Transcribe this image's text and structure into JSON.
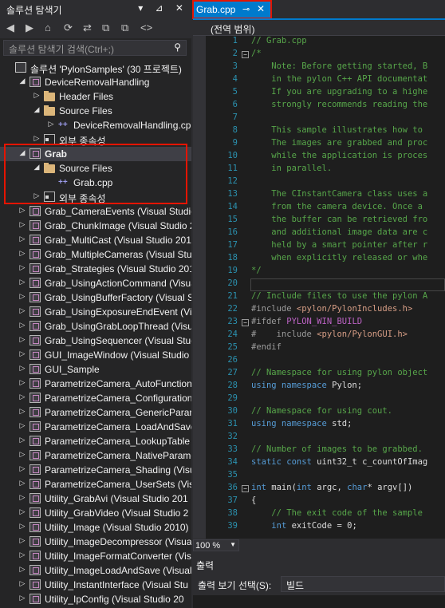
{
  "solution_explorer": {
    "title": "솔루션 탐색기",
    "title_buttons": "▾ ⊿ ✕",
    "toolbar": [
      "◀",
      "▶",
      "⌂",
      "⟳",
      "⇄",
      "⧉",
      "⧉",
      "<>"
    ],
    "search_placeholder": "솔루션 탐색기 검색(Ctrl+;)",
    "search_icon": "search-icon",
    "items": [
      {
        "label": "솔루션 'PylonSamples' (30 프로젝트)",
        "indent": 0,
        "arrow": "",
        "icon": "sln"
      },
      {
        "label": "DeviceRemovalHandling",
        "indent": 1,
        "arrow": "◢",
        "icon": "proj"
      },
      {
        "label": "Header Files",
        "indent": 2,
        "arrow": "▷",
        "icon": "folder"
      },
      {
        "label": "Source Files",
        "indent": 2,
        "arrow": "◢",
        "icon": "folder"
      },
      {
        "label": "DeviceRemovalHandling.cpp",
        "indent": 3,
        "arrow": "▷",
        "icon": "cpp"
      },
      {
        "label": "외부 종속성",
        "indent": 2,
        "arrow": "▷",
        "icon": "ref"
      },
      {
        "label": "Grab",
        "indent": 1,
        "arrow": "◢",
        "icon": "proj",
        "bold": true
      },
      {
        "label": "Source Files",
        "indent": 2,
        "arrow": "◢",
        "icon": "folder"
      },
      {
        "label": "Grab.cpp",
        "indent": 3,
        "arrow": "",
        "icon": "cpp"
      },
      {
        "label": "외부 종속성",
        "indent": 2,
        "arrow": "▷",
        "icon": "ref"
      },
      {
        "label": "Grab_CameraEvents (Visual Studio",
        "indent": 1,
        "arrow": "▷",
        "icon": "proj"
      },
      {
        "label": "Grab_ChunkImage (Visual Studio 20",
        "indent": 1,
        "arrow": "▷",
        "icon": "proj"
      },
      {
        "label": "Grab_MultiCast (Visual Studio 2010",
        "indent": 1,
        "arrow": "▷",
        "icon": "proj"
      },
      {
        "label": "Grab_MultipleCameras (Visual Stud",
        "indent": 1,
        "arrow": "▷",
        "icon": "proj"
      },
      {
        "label": "Grab_Strategies (Visual Studio 201",
        "indent": 1,
        "arrow": "▷",
        "icon": "proj"
      },
      {
        "label": "Grab_UsingActionCommand (Visual",
        "indent": 1,
        "arrow": "▷",
        "icon": "proj"
      },
      {
        "label": "Grab_UsingBufferFactory (Visual St",
        "indent": 1,
        "arrow": "▷",
        "icon": "proj"
      },
      {
        "label": "Grab_UsingExposureEndEvent (Visu",
        "indent": 1,
        "arrow": "▷",
        "icon": "proj"
      },
      {
        "label": "Grab_UsingGrabLoopThread (Visual",
        "indent": 1,
        "arrow": "▷",
        "icon": "proj"
      },
      {
        "label": "Grab_UsingSequencer (Visual Stud",
        "indent": 1,
        "arrow": "▷",
        "icon": "proj"
      },
      {
        "label": "GUI_ImageWindow (Visual Studio 2",
        "indent": 1,
        "arrow": "▷",
        "icon": "proj"
      },
      {
        "label": "GUI_Sample",
        "indent": 1,
        "arrow": "▷",
        "icon": "proj"
      },
      {
        "label": "ParametrizeCamera_AutoFunction",
        "indent": 1,
        "arrow": "▷",
        "icon": "proj"
      },
      {
        "label": "ParametrizeCamera_Configuration",
        "indent": 1,
        "arrow": "▷",
        "icon": "proj"
      },
      {
        "label": "ParametrizeCamera_GenericParam",
        "indent": 1,
        "arrow": "▷",
        "icon": "proj"
      },
      {
        "label": "ParametrizeCamera_LoadAndSave",
        "indent": 1,
        "arrow": "▷",
        "icon": "proj"
      },
      {
        "label": "ParametrizeCamera_LookupTable (",
        "indent": 1,
        "arrow": "▷",
        "icon": "proj"
      },
      {
        "label": "ParametrizeCamera_NativeParame",
        "indent": 1,
        "arrow": "▷",
        "icon": "proj"
      },
      {
        "label": "ParametrizeCamera_Shading (Visu",
        "indent": 1,
        "arrow": "▷",
        "icon": "proj"
      },
      {
        "label": "ParametrizeCamera_UserSets (Visu",
        "indent": 1,
        "arrow": "▷",
        "icon": "proj"
      },
      {
        "label": "Utility_GrabAvi (Visual Studio 201",
        "indent": 1,
        "arrow": "▷",
        "icon": "proj"
      },
      {
        "label": "Utility_GrabVideo (Visual Studio 2",
        "indent": 1,
        "arrow": "▷",
        "icon": "proj"
      },
      {
        "label": "Utility_Image (Visual Studio 2010)",
        "indent": 1,
        "arrow": "▷",
        "icon": "proj"
      },
      {
        "label": "Utility_ImageDecompressor (Visua",
        "indent": 1,
        "arrow": "▷",
        "icon": "proj"
      },
      {
        "label": "Utility_ImageFormatConverter (Visu",
        "indent": 1,
        "arrow": "▷",
        "icon": "proj"
      },
      {
        "label": "Utility_ImageLoadAndSave (Visual",
        "indent": 1,
        "arrow": "▷",
        "icon": "proj"
      },
      {
        "label": "Utility_InstantInterface (Visual Stu",
        "indent": 1,
        "arrow": "▷",
        "icon": "proj"
      },
      {
        "label": "Utility_IpConfig (Visual Studio 20",
        "indent": 1,
        "arrow": "▷",
        "icon": "proj"
      }
    ]
  },
  "editor": {
    "tab_label": "Grab.cpp",
    "tab_pin": "⊸",
    "tab_close": "✕",
    "scope": "(전역 범위)",
    "lines": [
      {
        "n": "1",
        "html": "<span class='cm'>// Grab.cpp</span>"
      },
      {
        "n": "2",
        "html": "<span class='cm'>/*</span>",
        "fold": "−"
      },
      {
        "n": "3",
        "html": "<span class='cm'>    Note: Before getting started, B</span>"
      },
      {
        "n": "4",
        "html": "<span class='cm'>    in the pylon C++ API documentat</span>"
      },
      {
        "n": "5",
        "html": "<span class='cm'>    If you are upgrading to a highe</span>"
      },
      {
        "n": "6",
        "html": "<span class='cm'>    strongly recommends reading the</span>"
      },
      {
        "n": "7",
        "html": ""
      },
      {
        "n": "8",
        "html": "<span class='cm'>    This sample illustrates how to </span>"
      },
      {
        "n": "9",
        "html": "<span class='cm'>    The images are grabbed and proc</span>"
      },
      {
        "n": "10",
        "html": "<span class='cm'>    while the application is proces</span>"
      },
      {
        "n": "11",
        "html": "<span class='cm'>    in parallel.</span>"
      },
      {
        "n": "12",
        "html": ""
      },
      {
        "n": "13",
        "html": "<span class='cm'>    The CInstantCamera class uses a</span>"
      },
      {
        "n": "14",
        "html": "<span class='cm'>    from the camera device. Once a </span>"
      },
      {
        "n": "15",
        "html": "<span class='cm'>    the buffer can be retrieved fro</span>"
      },
      {
        "n": "16",
        "html": "<span class='cm'>    and additional image data are c</span>"
      },
      {
        "n": "17",
        "html": "<span class='cm'>    held by a smart pointer after r</span>"
      },
      {
        "n": "18",
        "html": "<span class='cm'>    when explicitly released or whe</span>"
      },
      {
        "n": "19",
        "html": "<span class='cm'>*/</span>"
      },
      {
        "n": "20",
        "html": ""
      },
      {
        "n": "21",
        "html": "<span class='cm'>// Include files to use the pylon A</span>"
      },
      {
        "n": "22",
        "html": "<span class='pp'>#include </span><span class='st'>&lt;pylon/PylonIncludes.h&gt;</span>"
      },
      {
        "n": "23",
        "html": "<span class='pp'>#ifdef </span><span class='mc'>PYLON_WIN_BUILD</span>",
        "fold": "−"
      },
      {
        "n": "24",
        "html": "<span class='pp'>#    include </span><span class='st'>&lt;pylon/PylonGUI.h&gt;</span>"
      },
      {
        "n": "25",
        "html": "<span class='pp'>#endif</span>"
      },
      {
        "n": "26",
        "html": ""
      },
      {
        "n": "27",
        "html": "<span class='cm'>// Namespace for using pylon object</span>"
      },
      {
        "n": "28",
        "html": "<span class='kw'>using namespace</span> Pylon;"
      },
      {
        "n": "29",
        "html": ""
      },
      {
        "n": "30",
        "html": "<span class='cm'>// Namespace for using cout.</span>"
      },
      {
        "n": "31",
        "html": "<span class='kw'>using namespace</span> std;"
      },
      {
        "n": "32",
        "html": ""
      },
      {
        "n": "33",
        "html": "<span class='cm'>// Number of images to be grabbed.</span>"
      },
      {
        "n": "34",
        "html": "<span class='kw'>static const</span> uint32_t c_countOfImag"
      },
      {
        "n": "35",
        "html": ""
      },
      {
        "n": "36",
        "html": "<span class='kw'>int</span> main(<span class='kw'>int</span> argc, <span class='kw'>char</span>* argv[])",
        "fold": "−"
      },
      {
        "n": "37",
        "html": "{"
      },
      {
        "n": "38",
        "html": "    <span class='cm'>// The exit code of the sample</span>"
      },
      {
        "n": "39",
        "html": "    <span class='kw'>int</span> exitCode = 0;"
      }
    ]
  },
  "zoom": {
    "value": "100 %",
    "arrow": "▼"
  },
  "output": {
    "title": "출력",
    "source_label": "출력 보기 선택(S):",
    "source_value": "빌드"
  }
}
